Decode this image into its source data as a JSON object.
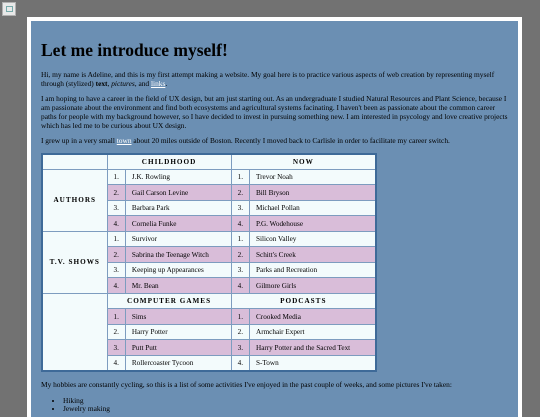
{
  "heading": "Let me introduce myself!",
  "intro": {
    "p1_a": "Hi, my name is Adeline, and this is my first attempt making a website. My goal here is to practice various aspects of web creation by representing myself through (stylized) ",
    "p1_bold": "text",
    "p1_b": ", ",
    "p1_italic": "pictures",
    "p1_c": ", and ",
    "p1_link": "links",
    "p1_d": ".",
    "p2": "I am hoping to have a career in the field of UX design, but am just starting out. As an undergraduate I studied Natural Resources and Plant Science, because I am passionate about the environment and find both ecosystems and agricultural systems facinating. I haven't been as passionate about the common career paths for people with my background however, so I have decided to invest in pursuing something new. I am interested in psycology and love creative projects which has led me to be curious about UX design.",
    "p3_a": "I grew up in a very small ",
    "p3_link": "town",
    "p3_b": " about 20 miles outside of Boston. Recently I moved back to Carlisle in order to facilitate my career switch."
  },
  "table": {
    "col_childhood": "CHILDHOOD",
    "col_now": "NOW",
    "col_games": "COMPUTER GAMES",
    "col_podcasts": "PODCASTS",
    "row_authors": "AUTHORS",
    "row_tvshows": "T.V. SHOWS",
    "authors": [
      {
        "n1": "1.",
        "child": "J.K. Rowling",
        "n2": "1.",
        "now": "Trevor Noah"
      },
      {
        "n1": "2.",
        "child": "Gail Carson Levine",
        "n2": "2.",
        "now": "Bill Bryson"
      },
      {
        "n1": "3.",
        "child": "Barbara Park",
        "n2": "3.",
        "now": "Michael Pollan"
      },
      {
        "n1": "4.",
        "child": "Cornelia Funke",
        "n2": "4.",
        "now": "P.G. Wodehouse"
      }
    ],
    "tvshows": [
      {
        "n1": "1.",
        "child": "Survivor",
        "n2": "1.",
        "now": "Silicon Valley"
      },
      {
        "n1": "2.",
        "child": "Sabrina the Teenage Witch",
        "n2": "2.",
        "now": "Schitt's Creek"
      },
      {
        "n1": "3.",
        "child": "Keeping up Appearances",
        "n2": "3.",
        "now": "Parks and Recreation"
      },
      {
        "n1": "4.",
        "child": "Mr. Bean",
        "n2": "4.",
        "now": "Gilmore Girls"
      }
    ],
    "games": [
      {
        "n1": "1.",
        "game": "Sims",
        "n2": "1.",
        "podcast": "Crooked Media"
      },
      {
        "n1": "2.",
        "game": "Harry Potter",
        "n2": "2.",
        "podcast": "Armchair Expert"
      },
      {
        "n1": "3.",
        "game": "Putt Putt",
        "n2": "3.",
        "podcast": "Harry Potter and the Sacred Text"
      },
      {
        "n1": "4.",
        "game": "Rollercoaster Tycoon",
        "n2": "4.",
        "podcast": "S-Town"
      }
    ]
  },
  "hobbies_text": "My hobbies are constantly cycling, so this is a list of some activities I've enjoyed in the past couple of weeks, and some pictures I've taken:",
  "hobbies": [
    "Hiking",
    "Jewelry making"
  ],
  "colors": {
    "background": "#727272",
    "panel": "#6b8fb3",
    "row_light": "#f3fbfc",
    "row_pink": "#d9bdd9",
    "table_border": "#3e6a98",
    "link": "#ffffff"
  },
  "icons": {
    "broken_image": "broken-image-icon"
  }
}
